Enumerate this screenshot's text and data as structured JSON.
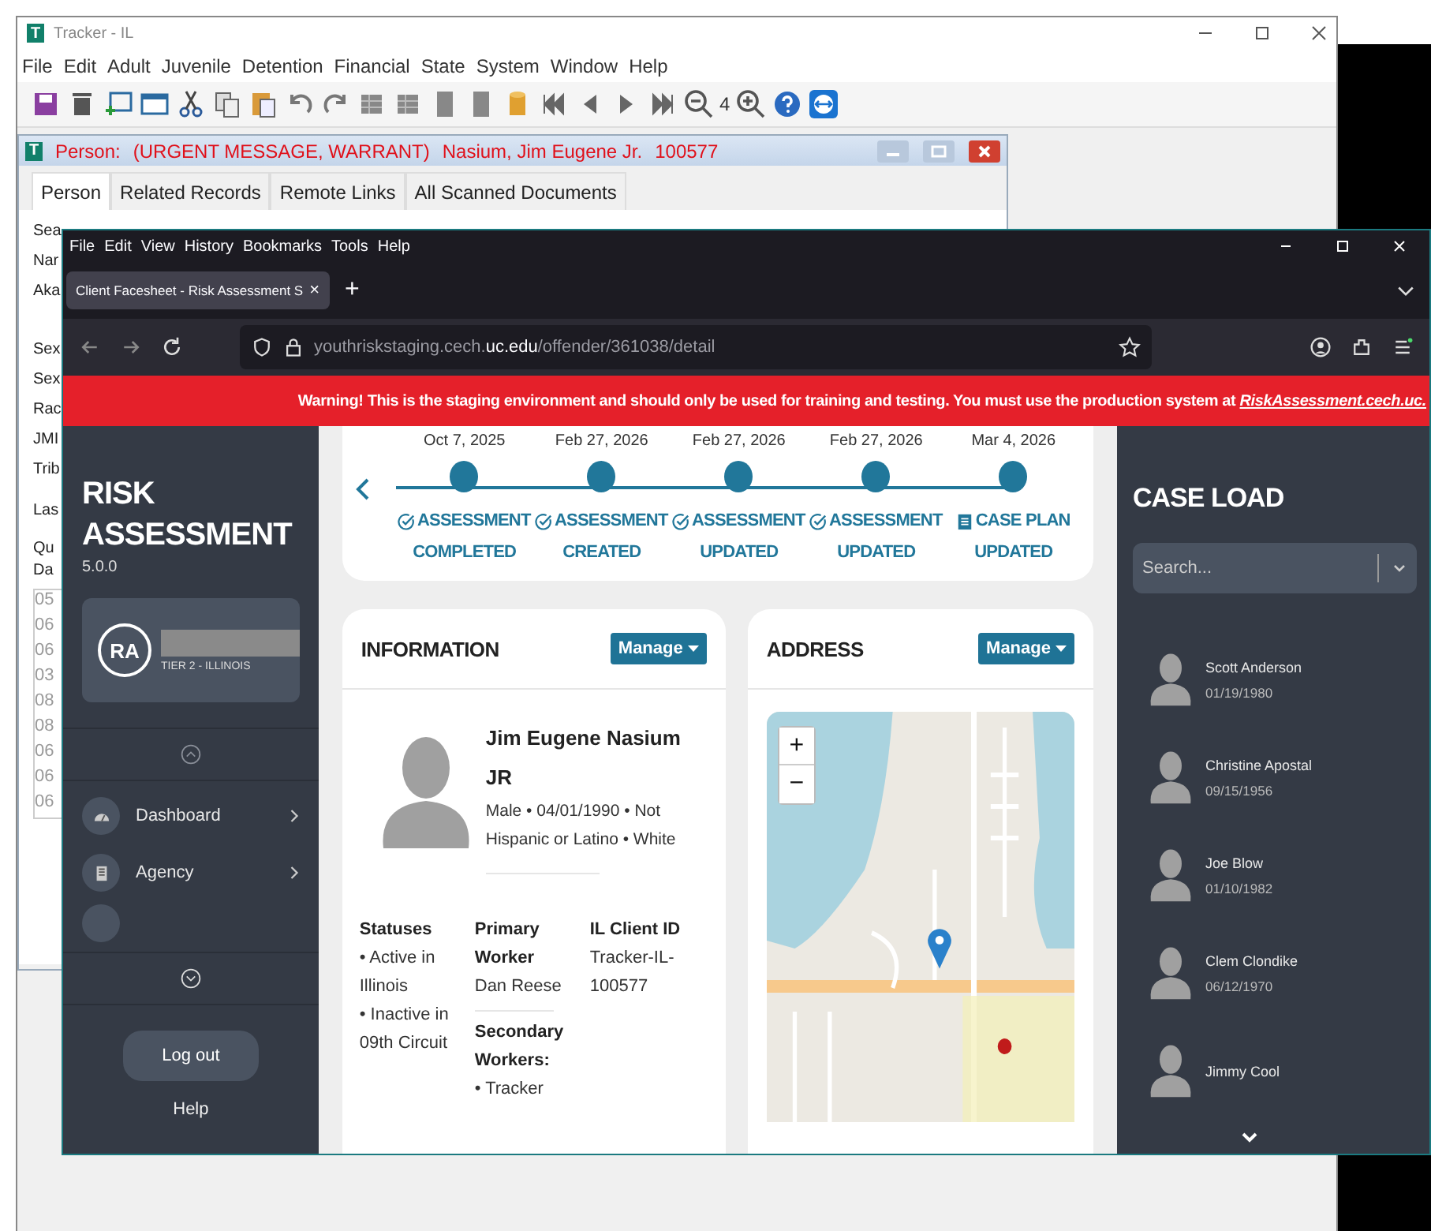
{
  "tracker_window": {
    "title": "Tracker - IL",
    "logo": "T",
    "menu": [
      "File",
      "Edit",
      "Adult",
      "Juvenile",
      "Detention",
      "Financial",
      "State",
      "System",
      "Window",
      "Help"
    ],
    "zoom_level": "4"
  },
  "person_window": {
    "logo": "T",
    "title_label": "Person:",
    "title_flags": "(URGENT MESSAGE, WARRANT)",
    "title_name": "Nasium, Jim Eugene Jr.",
    "title_id": "100577",
    "tabs": [
      {
        "label": "Person",
        "selected": true
      },
      {
        "label": "Related Records",
        "selected": false
      },
      {
        "label": "Remote Links",
        "selected": false
      },
      {
        "label": "All Scanned Documents",
        "selected": false
      }
    ],
    "field_labels": [
      "Sea",
      "Nar",
      "Aka",
      "Sex",
      "Sex",
      "Rac",
      "JMI",
      "Trib"
    ],
    "last_label": "Las",
    "group_label": "Qu",
    "list_header": "Da",
    "list_rows": [
      "05",
      "06",
      "06",
      "03",
      "08",
      "08",
      "06",
      "06",
      "06"
    ]
  },
  "browser": {
    "menu": [
      "File",
      "Edit",
      "View",
      "History",
      "Bookmarks",
      "Tools",
      "Help"
    ],
    "tab": {
      "title": "Client Facesheet - Risk Assessment S",
      "close": "×"
    },
    "new_tab": "+",
    "url_prefix": "youthriskstaging.cech.",
    "url_domain": "uc.edu",
    "url_path": "/offender/361038/detail"
  },
  "warning": {
    "text": "Warning! This is the staging environment and should only be used for training and testing. You must use the production system at",
    "link": "RiskAssessment.cech.uc."
  },
  "sidebar": {
    "title": "RISK ASSESSMENT",
    "version": "5.0.0",
    "user": {
      "logo": "RA",
      "tier": "TIER 2 - ILLINOIS"
    },
    "nav": [
      {
        "label": "Dashboard",
        "kind": "dashboard"
      },
      {
        "label": "Agency",
        "kind": "agency"
      }
    ],
    "logout": "Log out",
    "help": "Help"
  },
  "timeline": [
    {
      "date": "Oct 7, 2025",
      "kind": "assessment",
      "title": "ASSESSMENT",
      "status": "COMPLETED"
    },
    {
      "date": "Feb 27, 2026",
      "kind": "assessment",
      "title": "ASSESSMENT",
      "status": "CREATED"
    },
    {
      "date": "Feb 27, 2026",
      "kind": "assessment",
      "title": "ASSESSMENT",
      "status": "UPDATED"
    },
    {
      "date": "Feb 27, 2026",
      "kind": "assessment",
      "title": "ASSESSMENT",
      "status": "UPDATED"
    },
    {
      "date": "Mar 4, 2026",
      "kind": "case_plan",
      "title": "CASE PLAN",
      "status": "UPDATED"
    }
  ],
  "information": {
    "title": "INFORMATION",
    "manage": "Manage",
    "name": "Jim Eugene Nasium JR",
    "demographics": "Male • 04/01/1990 • Not Hispanic or Latino • White",
    "statuses": {
      "label": "Statuses",
      "items": [
        "• Active in Illinois",
        "• Inactive in 09th Circuit"
      ]
    },
    "primary_worker": {
      "label": "Primary Worker",
      "value": "Dan Reese"
    },
    "secondary_workers": {
      "label": "Secondary Workers:",
      "items": [
        "• Tracker"
      ]
    },
    "client_id": {
      "label": "IL Client ID",
      "value": "Tracker-IL-100577"
    }
  },
  "address": {
    "title": "ADDRESS",
    "manage": "Manage",
    "zoom_in": "+",
    "zoom_out": "−"
  },
  "case_load": {
    "title": "CASE LOAD",
    "search_placeholder": "Search...",
    "clients": [
      {
        "name": "Scott Anderson",
        "dob": "01/19/1980"
      },
      {
        "name": "Christine Apostal",
        "dob": "09/15/1956"
      },
      {
        "name": "Joe Blow",
        "dob": "01/10/1982"
      },
      {
        "name": "Clem Clondike",
        "dob": "06/12/1970"
      },
      {
        "name": "Jimmy Cool"
      }
    ]
  }
}
